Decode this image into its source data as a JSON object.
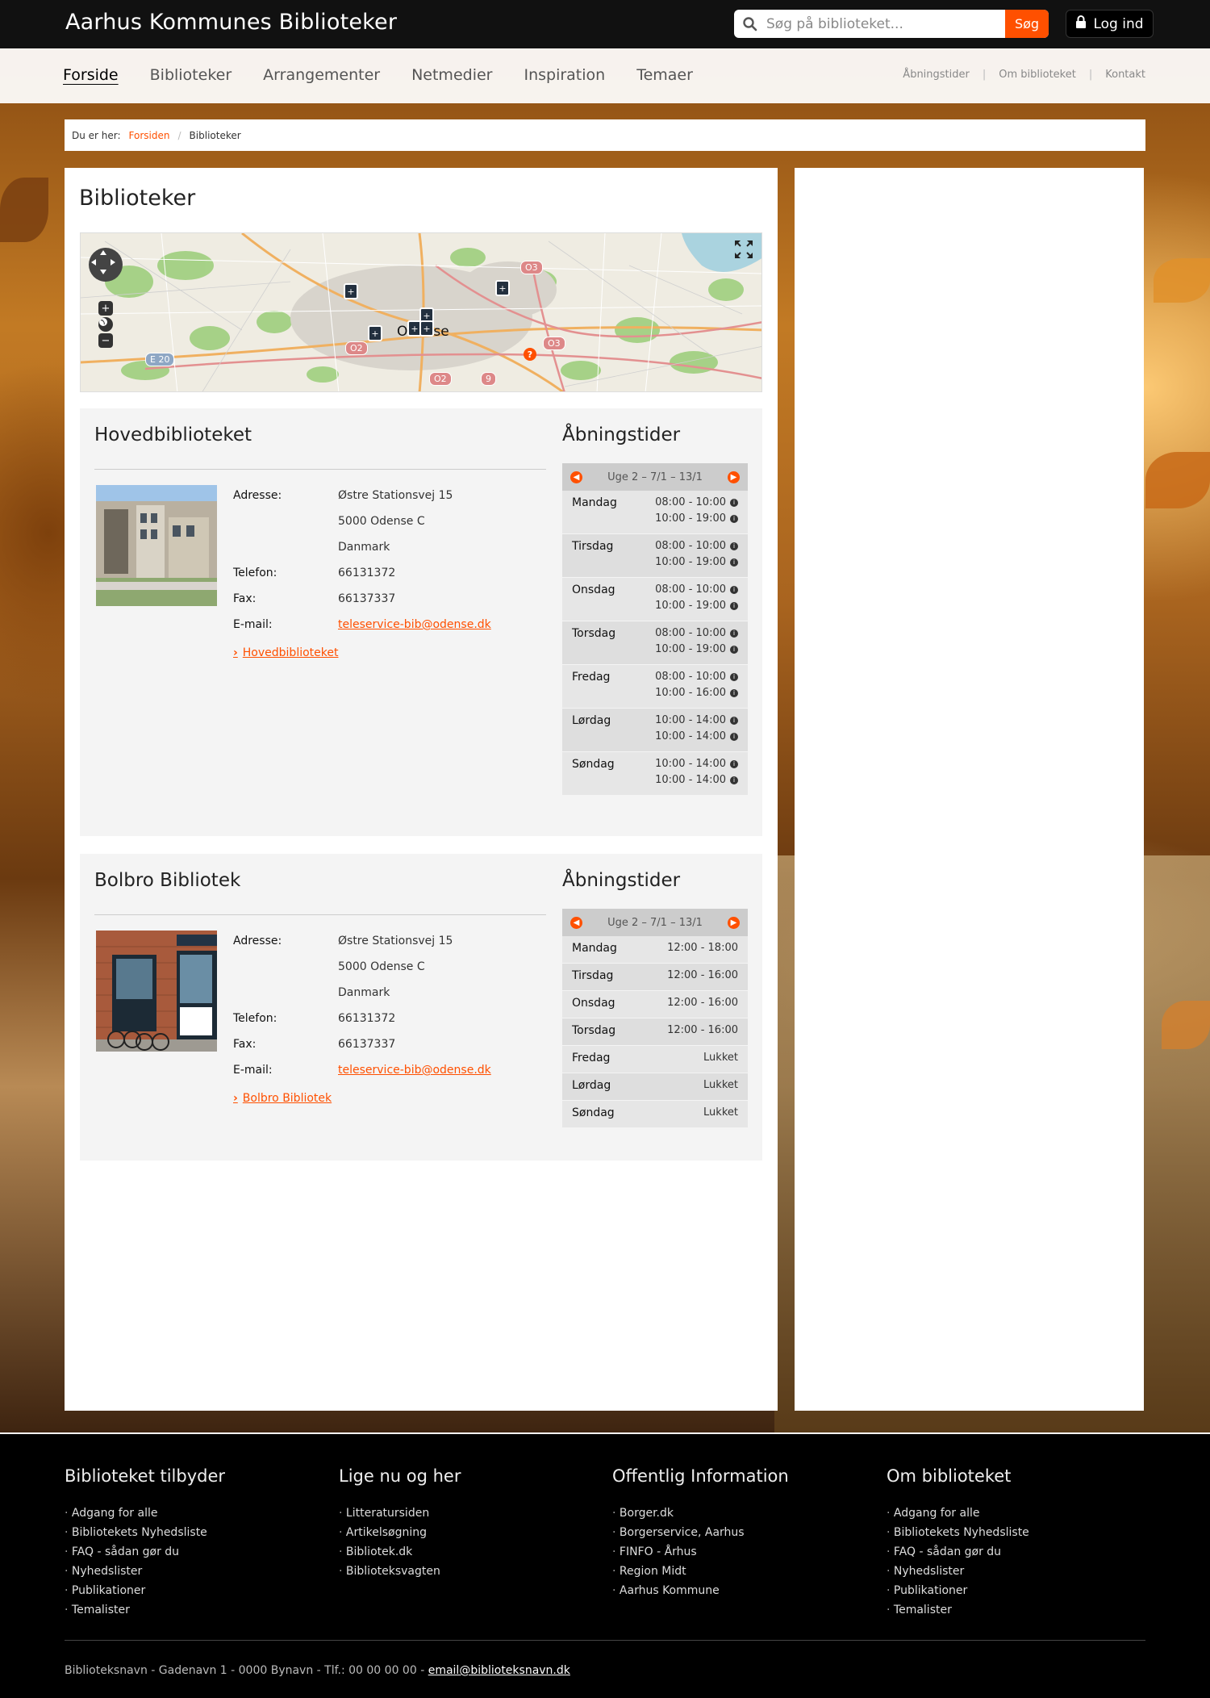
{
  "header": {
    "site_title": "Aarhus Kommunes Biblioteker",
    "search_placeholder": "Søg på biblioteket...",
    "search_button": "Søg",
    "login_label": "Log ind"
  },
  "nav": {
    "main": [
      "Forside",
      "Biblioteker",
      "Arrangementer",
      "Netmedier",
      "Inspiration",
      "Temaer"
    ],
    "utility": [
      "Åbningstider",
      "Om biblioteket",
      "Kontakt"
    ]
  },
  "breadcrumb": {
    "prefix": "Du er her:",
    "home": "Forsiden",
    "current": "Biblioteker"
  },
  "page": {
    "title": "Biblioteker",
    "map_city_label": "Odense"
  },
  "labels": {
    "address": "Adresse:",
    "phone": "Telefon:",
    "fax": "Fax:",
    "email": "E-mail:",
    "hours_title": "Åbningstider",
    "week": "Uge 2 – 7/1 – 13/1"
  },
  "libraries": [
    {
      "name": "Hovedbiblioteket",
      "address_line1": "Østre Stationsvej 15",
      "address_line2": "5000 Odense C",
      "country": "Danmark",
      "phone": "66131372",
      "fax": "66137337",
      "email": "teleservice-bib@odense.dk",
      "link_label": "Hovedbiblioteket",
      "hours": [
        {
          "day": "Mandag",
          "slots": [
            "08:00 - 10:00",
            "10:00 - 19:00"
          ]
        },
        {
          "day": "Tirsdag",
          "slots": [
            "08:00 - 10:00",
            "10:00 - 19:00"
          ]
        },
        {
          "day": "Onsdag",
          "slots": [
            "08:00 - 10:00",
            "10:00 - 19:00"
          ]
        },
        {
          "day": "Torsdag",
          "slots": [
            "08:00 - 10:00",
            "10:00 - 19:00"
          ]
        },
        {
          "day": "Fredag",
          "slots": [
            "08:00 - 10:00",
            "10:00 - 16:00"
          ]
        },
        {
          "day": "Lørdag",
          "slots": [
            "10:00 - 14:00",
            "10:00 - 14:00"
          ]
        },
        {
          "day": "Søndag",
          "slots": [
            "10:00 - 14:00",
            "10:00 - 14:00"
          ]
        }
      ]
    },
    {
      "name": "Bolbro Bibliotek",
      "address_line1": "Østre Stationsvej 15",
      "address_line2": "5000 Odense C",
      "country": "Danmark",
      "phone": "66131372",
      "fax": "66137337",
      "email": "teleservice-bib@odense.dk",
      "link_label": "Bolbro Bibliotek",
      "hours": [
        {
          "day": "Mandag",
          "time": "12:00 - 18:00"
        },
        {
          "day": "Tirsdag",
          "time": "12:00 - 16:00"
        },
        {
          "day": "Onsdag",
          "time": "12:00 - 16:00"
        },
        {
          "day": "Torsdag",
          "time": "12:00 - 16:00"
        },
        {
          "day": "Fredag",
          "time": "Lukket"
        },
        {
          "day": "Lørdag",
          "time": "Lukket"
        },
        {
          "day": "Søndag",
          "time": "Lukket"
        }
      ]
    }
  ],
  "footer": {
    "columns": [
      {
        "title": "Biblioteket tilbyder",
        "items": [
          "Adgang for alle",
          "Bibliotekets Nyhedsliste",
          "FAQ - sådan gør du",
          "Nyhedslister",
          "Publikationer",
          "Temalister"
        ]
      },
      {
        "title": "Lige nu og her",
        "items": [
          "Litteratursiden",
          "Artikelsøgning",
          "Bibliotek.dk",
          "Biblioteksvagten"
        ]
      },
      {
        "title": "Offentlig Information",
        "items": [
          "Borger.dk",
          "Borgerservice, Aarhus",
          "FINFO - Århus",
          "Region Midt",
          "Aarhus Kommune"
        ]
      },
      {
        "title": "Om biblioteket",
        "items": [
          "Adgang for alle",
          "Bibliotekets Nyhedsliste",
          "FAQ - sådan gør du",
          "Nyhedslister",
          "Publikationer",
          "Temalister"
        ]
      }
    ],
    "bottom_text": "Biblioteksnavn - Gadenavn 1 - 0000 Bynavn - Tlf.: 00 00 00 00 -",
    "bottom_email": "email@biblioteksnavn.dk"
  },
  "colors": {
    "accent": "#ff5000",
    "topbar": "#111111",
    "footer": "#000000"
  },
  "map_labels": {
    "road_e20": "E 20",
    "road_o2": "O2",
    "road_o3": "O3",
    "road_9": "9"
  }
}
